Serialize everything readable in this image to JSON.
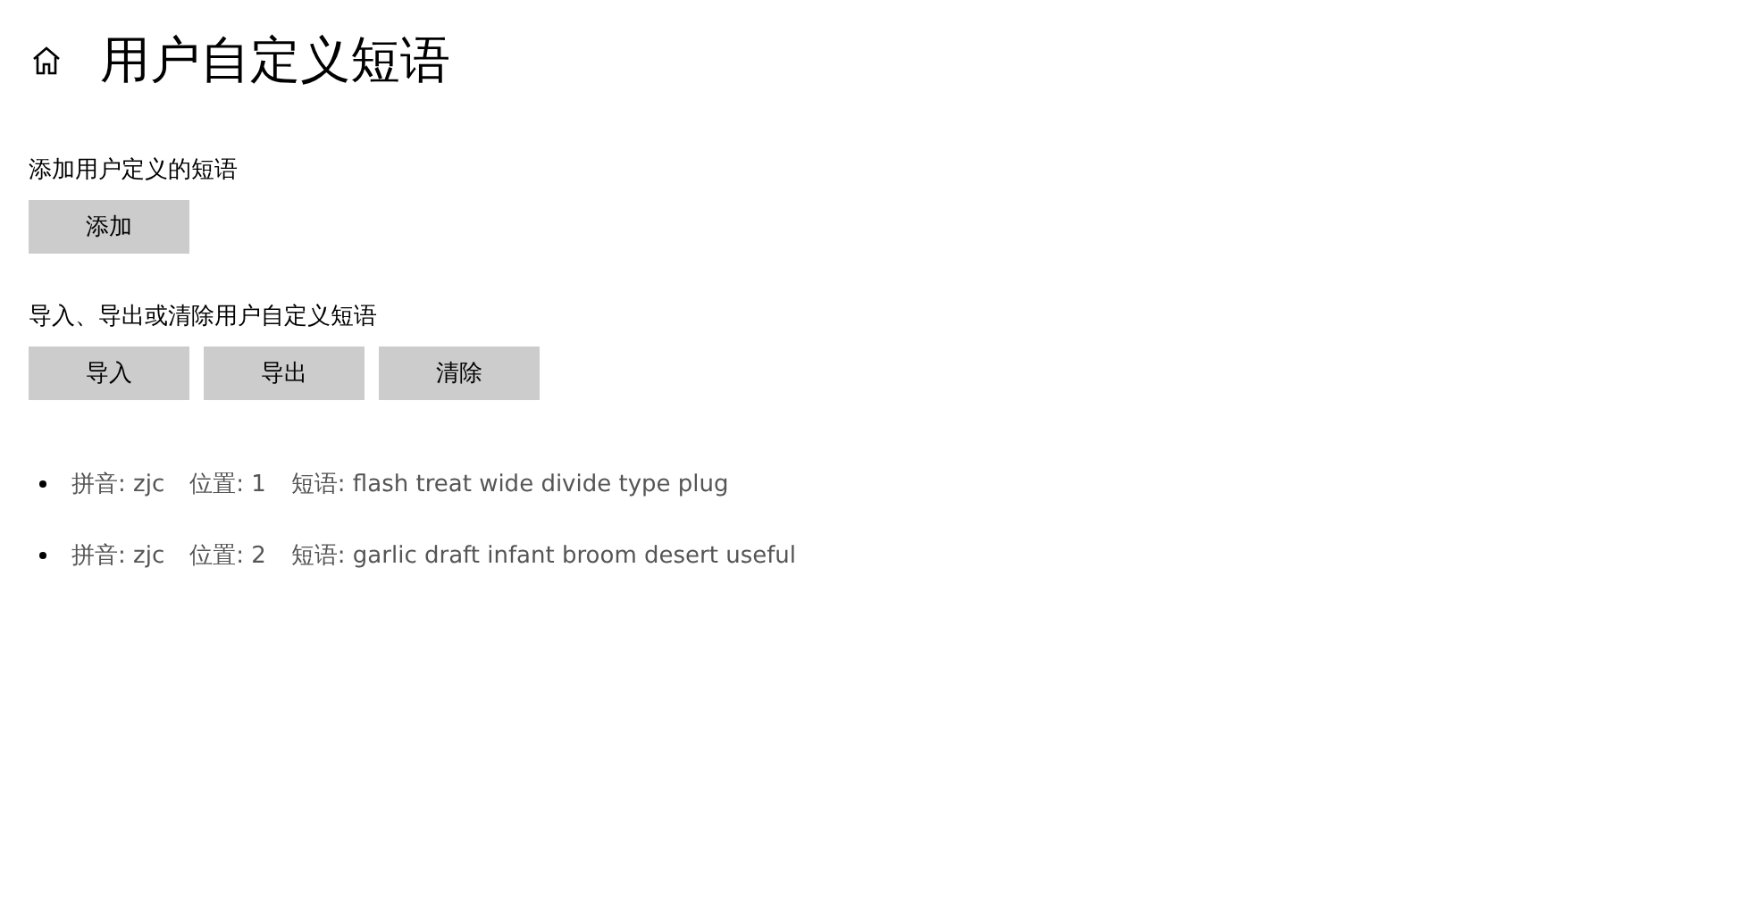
{
  "header": {
    "title": "用户自定义短语"
  },
  "sections": [
    {
      "label": "添加用户定义的短语",
      "buttons": [
        "添加"
      ]
    },
    {
      "label": "导入、导出或清除用户自定义短语",
      "buttons": [
        "导入",
        "导出",
        "清除"
      ]
    }
  ],
  "phrases": [
    {
      "pinyin": "拼音: zjc",
      "position": "位置: 1",
      "phrase": "短语: flash treat wide divide type plug"
    },
    {
      "pinyin": "拼音: zjc",
      "position": "位置: 2",
      "phrase": "短语: garlic draft infant broom desert useful"
    }
  ]
}
